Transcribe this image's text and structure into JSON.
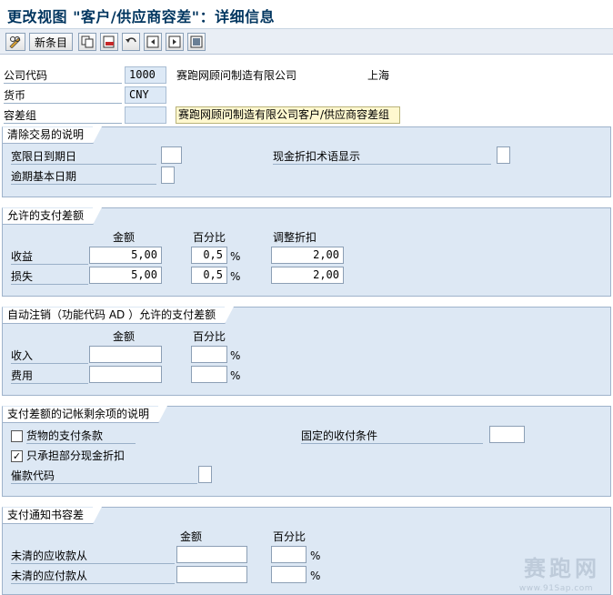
{
  "window": {
    "title": "更改视图 \"客户/供应商容差\"：详细信息"
  },
  "toolbar": {
    "edit_icon": "pencil-glasses-icon",
    "new_entries_label": "新条目",
    "buttons": [
      "copy-icon",
      "delete-icon",
      "undo-icon",
      "previous-entry-icon",
      "next-entry-icon",
      "select-all-icon"
    ]
  },
  "header": {
    "company_code_label": "公司代码",
    "company_code_value": "1000",
    "company_name": "赛跑网顾问制造有限公司",
    "city": "上海",
    "currency_label": "货币",
    "currency_value": "CNY",
    "tolerance_group_label": "容差组",
    "tolerance_group_value": "",
    "tolerance_group_desc": "赛跑网顾问制造有限公司客户/供应商容差组"
  },
  "clearing": {
    "title": "清除交易的说明",
    "grace_days_label": "宽限日到期日",
    "grace_days_value": "",
    "cash_discount_label": "现金折扣术语显示",
    "cash_discount_value": "",
    "arrears_base_label": "逾期基本日期",
    "arrears_base_value": ""
  },
  "permitted": {
    "title": "允许的支付差额",
    "col_amount": "金额",
    "col_percent": "百分比",
    "col_adjust": "调整折扣",
    "pct_symbol": "%",
    "gain_label": "收益",
    "gain_amount": "5,00",
    "gain_percent": "0,5",
    "gain_adjust": "2,00",
    "loss_label": "损失",
    "loss_amount": "5,00",
    "loss_percent": "0,5",
    "loss_adjust": "2,00"
  },
  "auto_writeoff": {
    "title": "自动注销（功能代码 AD ）允许的支付差额",
    "col_amount": "金额",
    "col_percent": "百分比",
    "pct_symbol": "%",
    "revenue_label": "收入",
    "revenue_amount": "",
    "revenue_percent": "",
    "expense_label": "费用",
    "expense_amount": "",
    "expense_percent": ""
  },
  "residual": {
    "title": "支付差额的记帐剩余项的说明",
    "goods_terms_label": "货物的支付条款",
    "goods_terms_checked": false,
    "partial_discount_label": "只承担部分现金折扣",
    "partial_discount_checked": true,
    "fixed_terms_label": "固定的收付条件",
    "fixed_terms_value": "",
    "dunning_key_label": "催款代码",
    "dunning_key_value": ""
  },
  "notice": {
    "title": "支付通知书容差",
    "col_amount": "金额",
    "col_percent": "百分比",
    "pct_symbol": "%",
    "receivable_label": "未清的应收款从",
    "receivable_amount": "",
    "receivable_percent": "",
    "payable_label": "未清的应付款从",
    "payable_amount": "",
    "payable_percent": ""
  },
  "watermark": {
    "logo_text": "赛跑网",
    "url": "www.91Sap.com"
  },
  "colors": {
    "group_bg": "#dde8f4",
    "readonly_field": "#dde9f6",
    "title_color": "#00355f"
  }
}
